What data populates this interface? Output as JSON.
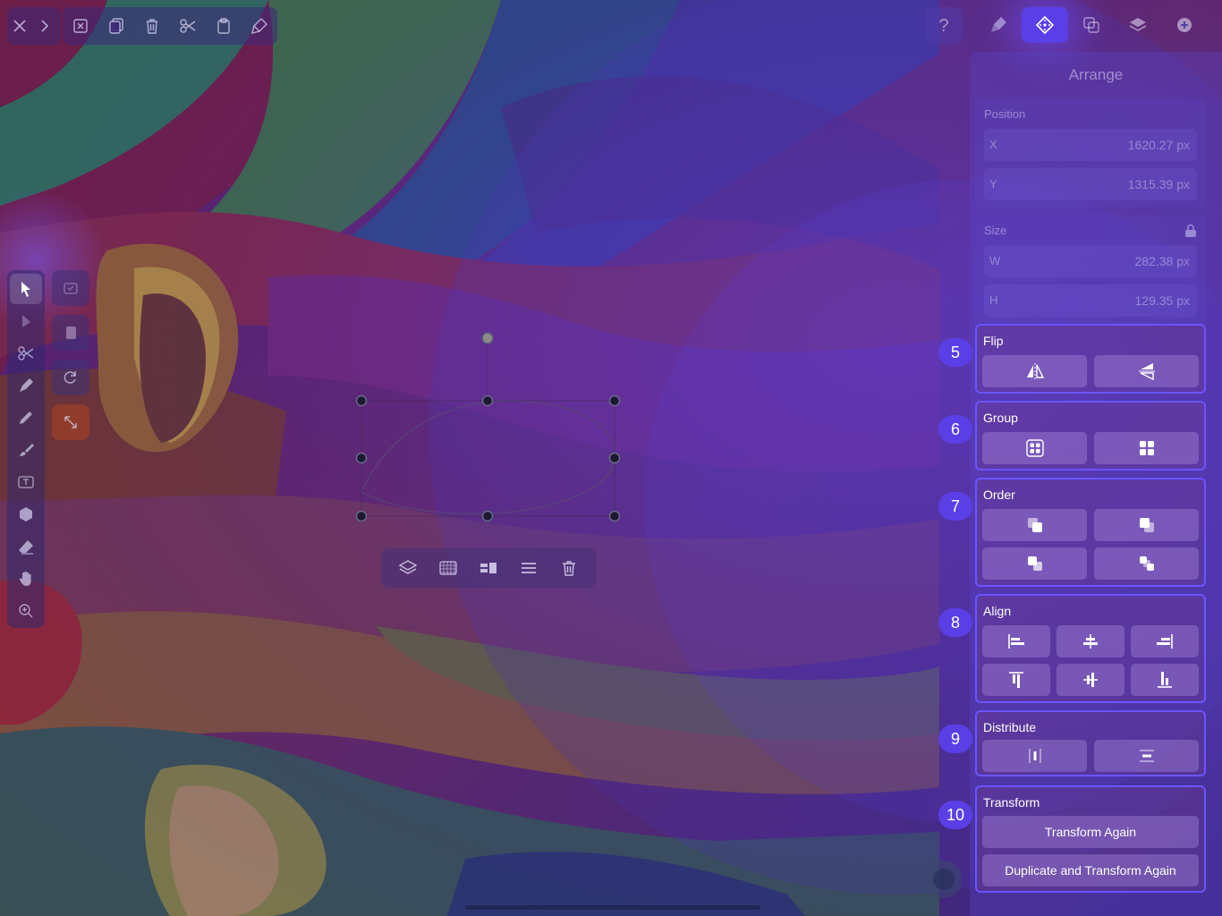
{
  "top_toolbar": {
    "items": [
      "close-icon",
      "forward-icon",
      "deselect-icon",
      "duplicate-icon",
      "trash-icon",
      "scissors-icon",
      "paste-icon",
      "paste-style-icon"
    ]
  },
  "tools": [
    "select-tool",
    "node-tool",
    "scissors-tool",
    "pen-tool",
    "pencil-tool",
    "brush-tool",
    "text-tool",
    "shape-tool",
    "eraser-tool",
    "hand-tool",
    "zoom-tool"
  ],
  "header": {
    "help_label": "?",
    "tabs": [
      "style-tab",
      "arrange-tab",
      "boolean-tab",
      "layers-tab",
      "more-tab"
    ],
    "active_tab": "arrange-tab"
  },
  "panel": {
    "title": "Arrange",
    "position": {
      "label": "Position",
      "x_key": "X",
      "x_value": "1620.27 px",
      "y_key": "Y",
      "y_value": "1315.39 px"
    },
    "size": {
      "label": "Size",
      "w_key": "W",
      "w_value": "282.38 px",
      "h_key": "H",
      "h_value": "129.35 px"
    },
    "flip": {
      "label": "Flip",
      "badge": "5"
    },
    "group": {
      "label": "Group",
      "badge": "6"
    },
    "order": {
      "label": "Order",
      "badge": "7"
    },
    "align": {
      "label": "Align",
      "badge": "8"
    },
    "distribute": {
      "label": "Distribute",
      "badge": "9"
    },
    "transform": {
      "label": "Transform",
      "badge": "10",
      "transform_again": "Transform Again",
      "duplicate_transform_again": "Duplicate and Transform Again"
    }
  },
  "colors": {
    "accent": "#5a3fe6",
    "section_border": "#6b54ff"
  }
}
